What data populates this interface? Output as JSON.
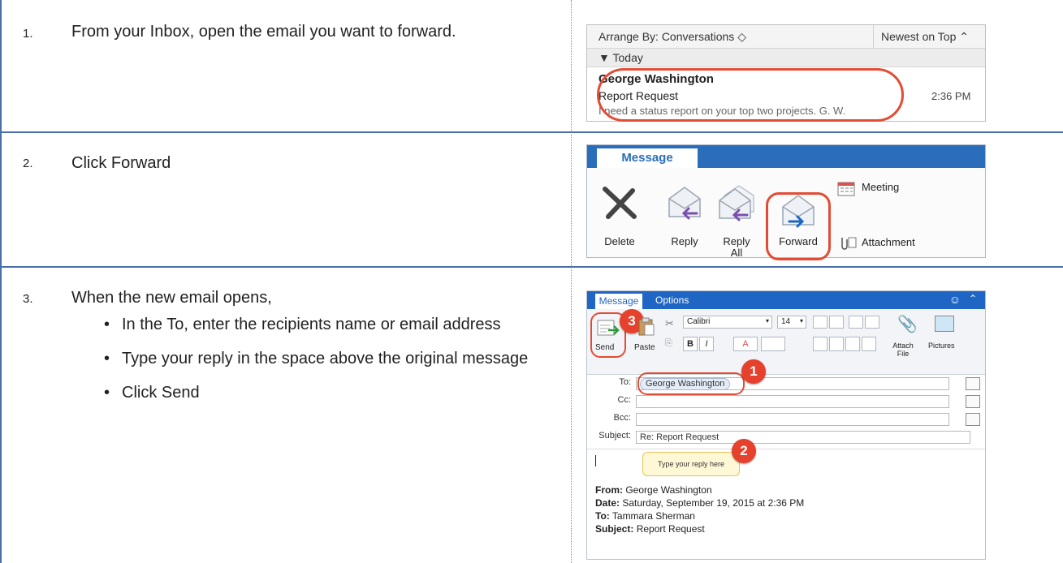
{
  "steps": [
    {
      "number": "1.",
      "text": "From your Inbox, open the email you want to forward."
    },
    {
      "number": "2.",
      "text": "Click Forward"
    },
    {
      "number": "3.",
      "text": "When the new email opens,"
    }
  ],
  "step3_bullets": [
    "In the To, enter the recipients name or email address",
    "Type your reply in the space above the original message",
    "Click Send"
  ],
  "shot1": {
    "arrange": "Arrange By: Conversations ◇",
    "newest": "Newest on Top ⌃",
    "today": "▼ Today",
    "sender": "George Washington",
    "subject": "Report Request",
    "preview": "I need a status report on your top two projects. G. W.",
    "time": "2:36 PM"
  },
  "shot2": {
    "tab": "Message",
    "delete": "Delete",
    "reply": "Reply",
    "reply_all": "Reply All",
    "forward": "Forward",
    "meeting": "Meeting",
    "attachment": "Attachment"
  },
  "shot3": {
    "tab_message": "Message",
    "tab_options": "Options",
    "send": "Send",
    "paste": "Paste",
    "font": "Calibri",
    "size": "14",
    "attach": "Attach File",
    "pictures": "Pictures",
    "to_label": "To:",
    "cc_label": "Cc:",
    "bcc_label": "Bcc:",
    "subject_label": "Subject:",
    "to_value": "George Washington",
    "subject_value": "Re: Report Request",
    "callout": "Type your reply here",
    "badge1": "1",
    "badge2": "2",
    "badge3": "3",
    "from_label": "From:",
    "from_value": "George Washington",
    "date_label": "Date:",
    "date_value": "Saturday, September 19, 2015 at 2:36 PM",
    "to2_label": "To:",
    "to2_value": "Tammara Sherman",
    "subj2_label": "Subject:",
    "subj2_value": "Report Request"
  },
  "colors": {
    "ring": "#e24c35",
    "tab_blue": "#2a6ebb",
    "rule_blue": "#4a6ea8"
  }
}
